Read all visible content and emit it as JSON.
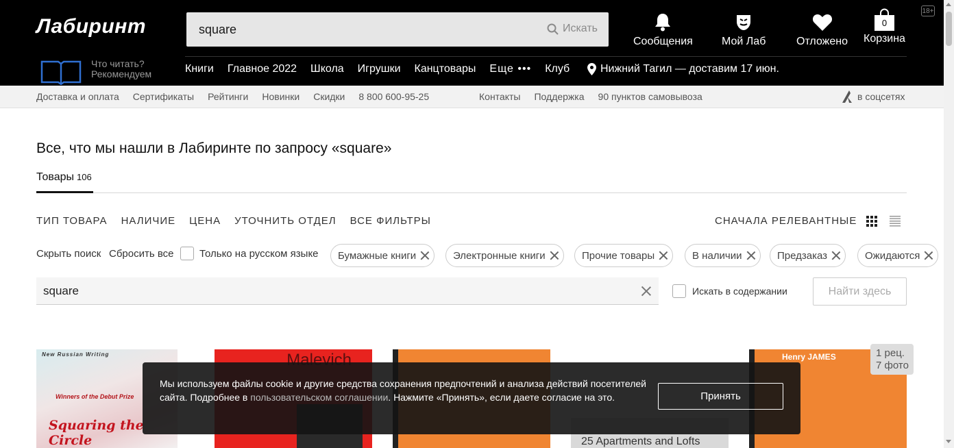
{
  "header": {
    "logo": "Лабиринт",
    "search": {
      "value": "square",
      "button_label": "Искать"
    },
    "icons": [
      {
        "label": "Сообщения",
        "icon": "bell-icon"
      },
      {
        "label": "Мой Лаб",
        "icon": "profile-icon"
      },
      {
        "label": "Отложено",
        "icon": "heart-icon"
      },
      {
        "label": "Корзина",
        "icon": "bag-icon",
        "count": "0"
      }
    ],
    "age_badge": "18+",
    "recommend": {
      "line1": "Что читать?",
      "line2": "Рекомендуем"
    },
    "nav": [
      "Книги",
      "Главное 2022",
      "Школа",
      "Игрушки",
      "Канцтовары",
      "Еще •••",
      "Клуб"
    ],
    "location": "Нижний Тагил — доставим 17 июн."
  },
  "subbar": {
    "left": [
      "Доставка и оплата",
      "Сертификаты",
      "Рейтинги",
      "Новинки",
      "Скидки",
      "8 800 600-95-25"
    ],
    "mid": [
      "Контакты",
      "Поддержка",
      "90 пунктов самовывоза"
    ],
    "right": "в соцсетях"
  },
  "main": {
    "title": "Все, что мы нашли в Лабиринте по запросу «square»",
    "tab": {
      "label": "Товары",
      "count": "106"
    },
    "filters": [
      "ТИП ТОВАРА",
      "НАЛИЧИЕ",
      "ЦЕНА",
      "УТОЧНИТЬ ОТДЕЛ",
      "ВСЕ ФИЛЬТРЫ"
    ],
    "sort": "СНАЧАЛА РЕЛЕВАНТНЫЕ",
    "hide_search": "Скрыть поиск",
    "reset_all": "Сбросить все",
    "russian_only": "Только на русском языке",
    "chips": [
      "Бумажные книги",
      "Электронные книги",
      "Прочие товары",
      "В наличии",
      "Предзаказ",
      "Ожидаются"
    ],
    "inner_search": {
      "value": "square"
    },
    "search_in_content": "Искать в содержании",
    "find_here": "Найти здесь"
  },
  "products": [
    {
      "cover_lines": [
        "New Russian Writing",
        "Winners of the Debut Prize",
        "Squaring the Circle"
      ]
    },
    {
      "cover_lines": [
        "Malevich"
      ]
    },
    {
      "cover_lines": []
    },
    {
      "cover_lines": [
        "25 Apartments and Lofts"
      ]
    },
    {
      "cover_lines": [
        "Henry JAMES"
      ]
    }
  ],
  "badge": {
    "line1": "1 рец.",
    "line2": "7 фото"
  },
  "cookie": {
    "text1": "Мы используем файлы cookie и другие средства сохранения предпочтений и анализа действий посетителей сайта. Подробнее в ",
    "link": "пользовательском соглашении",
    "text2": ". Нажмите «Принять», если даете согласие на это.",
    "button": "Принять"
  }
}
